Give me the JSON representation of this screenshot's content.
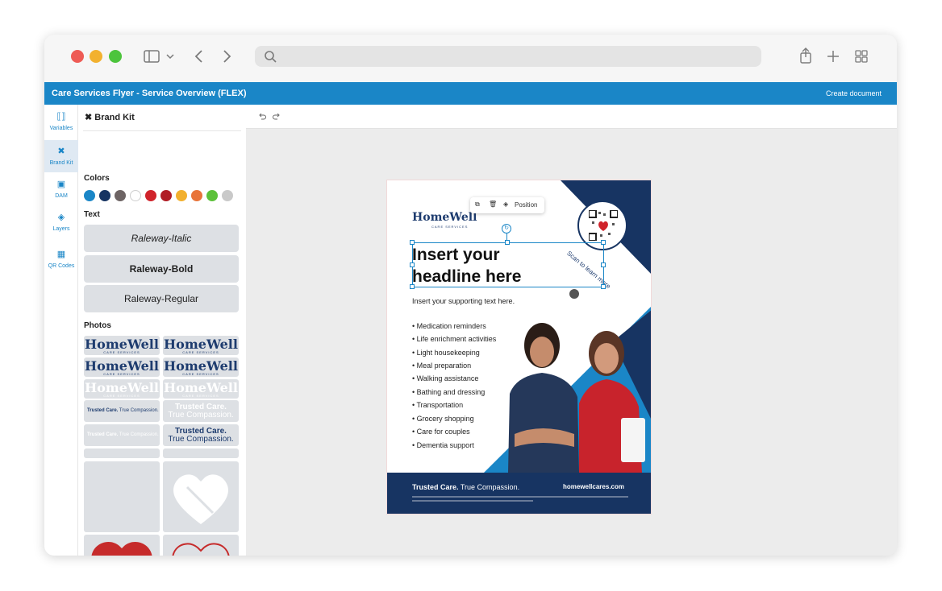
{
  "app": {
    "title": "Care Services Flyer - Service Overview (FLEX)",
    "create_label": "Create document"
  },
  "colors": {
    "accent": "#1a86c7",
    "brand_navy": "#173462",
    "brand_red": "#d0232b"
  },
  "browser": {
    "icons": [
      "sidebar-icon",
      "chevron-down-icon",
      "back-icon",
      "forward-icon",
      "search-icon",
      "share-icon",
      "new-tab-icon",
      "tab-overview-icon"
    ]
  },
  "rail": {
    "items": [
      {
        "label": "Variables",
        "icon": "variables-icon"
      },
      {
        "label": "Brand Kit",
        "icon": "brand-kit-icon"
      },
      {
        "label": "DAM",
        "icon": "dam-icon"
      },
      {
        "label": "Layers",
        "icon": "layers-icon"
      },
      {
        "label": "QR Codes",
        "icon": "qr-code-icon"
      }
    ]
  },
  "panel": {
    "title": "Brand Kit",
    "colors_label": "Colors",
    "swatches": [
      "#1a86c7",
      "#173462",
      "#6d6464",
      "#ffffff",
      "#d0232b",
      "#b01c24",
      "#f2b02e",
      "#e8743a",
      "#5cc13a",
      "#c9c9c9"
    ],
    "text_label": "Text",
    "fonts": [
      "Raleway-Italic",
      "Raleway-Bold",
      "Raleway-Regular"
    ],
    "photos_label": "Photos",
    "logo_word": "HomeWell",
    "logo_sub": "CARE SERVICES",
    "tagline_bold": "Trusted Care.",
    "tagline_rest": "True Compassion."
  },
  "toolbar": {
    "undo_icon": "undo-icon",
    "redo_icon": "redo-icon"
  },
  "flyer": {
    "context_menu": {
      "position_label": "Position"
    },
    "logo_word": "HomeWell",
    "logo_sub": "CARE SERVICES",
    "qr_caption": "Scan to learn more",
    "headline_line1": "Insert your",
    "headline_line2": "headline here",
    "supporting": "Insert your supporting text here.",
    "services": [
      "• Medication reminders",
      "• Life enrichment activities",
      "• Light housekeeping",
      "• Meal preparation",
      "• Walking assistance",
      "• Bathing and dressing",
      "• Transportation",
      "• Grocery shopping",
      "• Care for couples",
      "• Dementia support"
    ],
    "footer_bold": "Trusted Care.",
    "footer_rest": "True Compassion.",
    "website": "homewellcares.com"
  }
}
